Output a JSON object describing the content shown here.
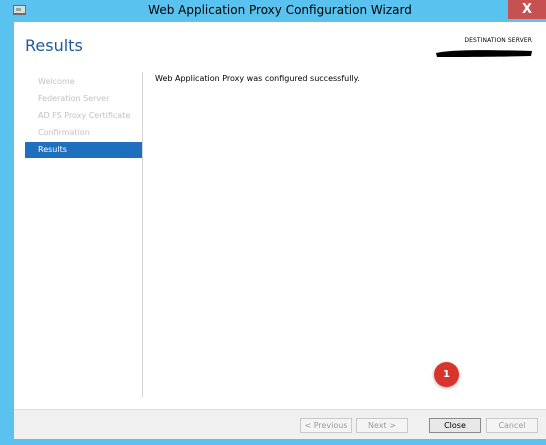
{
  "window": {
    "title": "Web Application Proxy Configuration Wizard",
    "close_glyph": "X",
    "accent_color": "#5ac2ee"
  },
  "header": {
    "page_title": "Results",
    "destination_label": "DESTINATION SERVER"
  },
  "nav": {
    "items": [
      {
        "label": "Welcome"
      },
      {
        "label": "Federation Server"
      },
      {
        "label": "AD FS Proxy Certificate"
      },
      {
        "label": "Confirmation"
      },
      {
        "label": "Results"
      }
    ],
    "active_color": "#1f6fbf"
  },
  "main": {
    "message": "Web Application Proxy was configured successfully."
  },
  "footer": {
    "previous_label": "< Previous",
    "next_label": "Next >",
    "close_label": "Close",
    "cancel_label": "Cancel"
  },
  "annotation": {
    "badge_number": "1",
    "badge_color": "#d9342b"
  }
}
